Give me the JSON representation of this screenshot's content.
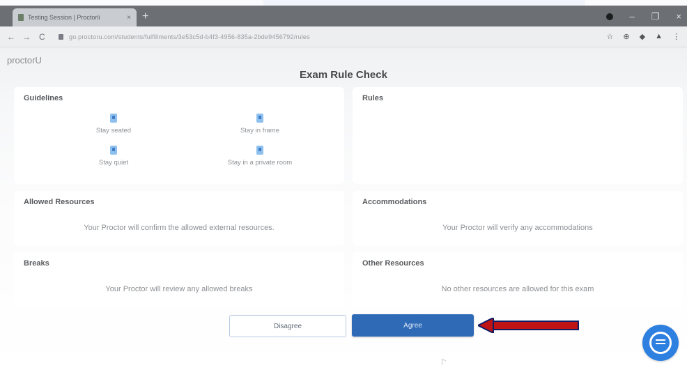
{
  "browser": {
    "tab_title": "Testing Session | Proctorli",
    "tab_close": "×",
    "new_tab": "+",
    "url": "go.proctoru.com/students/fulfillments/3e53c5d-b4f3-4956-835a-2bde9456792/rules",
    "nav": {
      "back": "←",
      "forward": "→",
      "reload": "C"
    },
    "window_controls": {
      "minimize": "–",
      "maximize": "❐",
      "close": "×"
    },
    "extensions": [
      "☆",
      "⊕",
      "◆",
      "▲",
      "⋮"
    ]
  },
  "page": {
    "logo": "proctorU",
    "title": "Exam Rule Check"
  },
  "guidelines": {
    "heading": "Guidelines",
    "items": [
      {
        "label": "Stay seated",
        "icon": "seated-person-icon"
      },
      {
        "label": "Stay in frame",
        "icon": "in-frame-icon"
      },
      {
        "label": "Stay quiet",
        "icon": "quiet-icon"
      },
      {
        "label": "Stay in a private room",
        "icon": "private-room-icon"
      }
    ]
  },
  "rules": {
    "heading": "Rules"
  },
  "allowed_resources": {
    "heading": "Allowed Resources",
    "text": "Your Proctor will confirm the allowed external resources."
  },
  "accommodations": {
    "heading": "Accommodations",
    "text": "Your Proctor will verify any accommodations"
  },
  "breaks": {
    "heading": "Breaks",
    "text": "Your Proctor will review any allowed breaks"
  },
  "other_resources": {
    "heading": "Other Resources",
    "text": "No other resources are allowed for this exam"
  },
  "actions": {
    "disagree": "Disagree",
    "agree": "Agree"
  },
  "colors": {
    "agree_button": "#2e6ab6",
    "annotation_arrow": "#c01313",
    "chat_button": "#2d7fe0"
  }
}
